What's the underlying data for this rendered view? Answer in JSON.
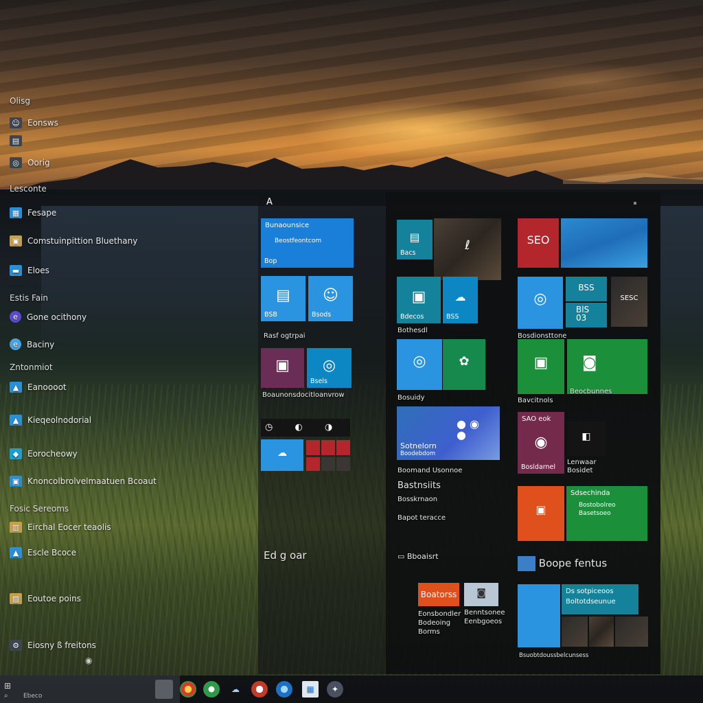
{
  "left_list": {
    "items": [
      {
        "label": "Olisg",
        "icon": "none"
      },
      {
        "label": "Eonsws",
        "icon": "user-icon"
      },
      {
        "label": "",
        "icon": "document-icon"
      },
      {
        "label": "Oorig",
        "icon": "photos-icon"
      },
      {
        "label": "Lesconte",
        "icon": "none"
      },
      {
        "label": "Fesape",
        "icon": "app-icon"
      },
      {
        "label": "Comstuinpittion Bluethany",
        "icon": "store-icon"
      },
      {
        "label": "Eloes",
        "icon": "folder-icon"
      },
      {
        "label": "Estis Fain",
        "icon": "none"
      },
      {
        "label": "Gone ocithony",
        "icon": "edge-icon"
      },
      {
        "label": "Baciny",
        "icon": "browser-icon"
      },
      {
        "label": "Zntonmiot",
        "icon": "none"
      },
      {
        "label": "Eanoooot",
        "icon": "app-icon"
      },
      {
        "label": "Kieqeolnodorial",
        "icon": "app-icon"
      },
      {
        "label": "Eorocheowy",
        "icon": "app-icon"
      },
      {
        "label": "Knoncolbrolvelmaatuen Bcoaut",
        "icon": "app-icon"
      },
      {
        "label": "Fosic Sereoms",
        "icon": "none"
      },
      {
        "label": "Eirchal Eocer teaolis",
        "icon": "map-icon"
      },
      {
        "label": "Escle Bcoce",
        "icon": "app-icon"
      },
      {
        "label": "Eoutoe poins",
        "icon": "image-icon"
      },
      {
        "label": "Eiosny ß freitons",
        "icon": "settings-icon"
      }
    ]
  },
  "panel": {
    "title": "A"
  },
  "tiles": {
    "c1_wide": {
      "top": "Bunaounsice",
      "mid": "Beostfeontcom",
      "bottom": "Bop"
    },
    "c1_sq1": {
      "label": "BSB"
    },
    "c1_sq2": {
      "label": "Bsods"
    },
    "c1_row_caption": "Rasf ogtrpai",
    "c1_sq3": {
      "label": ""
    },
    "c1_sq4": {
      "label": "Bsels"
    },
    "c1_caption2": "Boaunonsdocitloanvrow",
    "c1_small_caption": "Ed g oar",
    "c2_top1": {
      "label": "Bacs"
    },
    "c2_top2": {
      "label": ""
    },
    "c2_mid1": {
      "label": "Bdecos"
    },
    "c2_mid2": {
      "label": "BSS"
    },
    "c2_mid_caption": "Bothesdl",
    "c2_row3a": {
      "label": ""
    },
    "c2_row3b": {
      "label": ""
    },
    "c2_row3_caption": "Bosuidy",
    "c2_wide": {
      "label": "Sotnelorn",
      "sub": "Boodebdom"
    },
    "c2_wide_caption": "Boomand Usonnoe",
    "c2_list": [
      "Bastnsiits",
      "Bosskrnaon",
      "Bapot teracce"
    ],
    "c2_group": "Bboaisrt",
    "c2_small1": {
      "label": "Boatorss"
    },
    "c2_small1_caption": [
      "Eonsbondler",
      "Bodeoing",
      "Borms"
    ],
    "c2_small2_caption": [
      "Benntsonee",
      "Eenbgoeos"
    ],
    "c3_top1": {
      "label": "SEO"
    },
    "c3_top2": {
      "label": ""
    },
    "c3_mid1": {
      "label": ""
    },
    "c3_mid2a": {
      "label": "BSS"
    },
    "c3_mid2b": {
      "label": "BlS 03"
    },
    "c3_mid3": {
      "label": "SESC"
    },
    "c3_mid_caption": "Bosdionsttone",
    "c3_row3_caption": "Bavcitnols",
    "c3_row3b_caption": "Beocbunnes",
    "c3_row4a": {
      "label": "SAO eok",
      "sub": "Bosldarnel"
    },
    "c3_row4b": {
      "label": "",
      "sub": "Lenwaar\nBosidet"
    },
    "c3_row5b": {
      "label": "Sdsechinda",
      "sub": "Bostobolreo\nBasetsoeo"
    },
    "c3_group": "Boope fentus",
    "c3_bottom": {
      "label": "Ds sotpiceoos",
      "sub": "Boltotdseunue"
    },
    "c3_bottom_caption": "Bsuobtdoussbelcunsess"
  },
  "taskbar": {
    "search_label": "Ebeco"
  },
  "colors": {
    "tile_blue": "#1a7fd8",
    "tile_green": "#1c8f3a",
    "tile_red": "#b3262b",
    "tile_orange": "#e0501c",
    "tile_purple": "#6a2d55"
  }
}
